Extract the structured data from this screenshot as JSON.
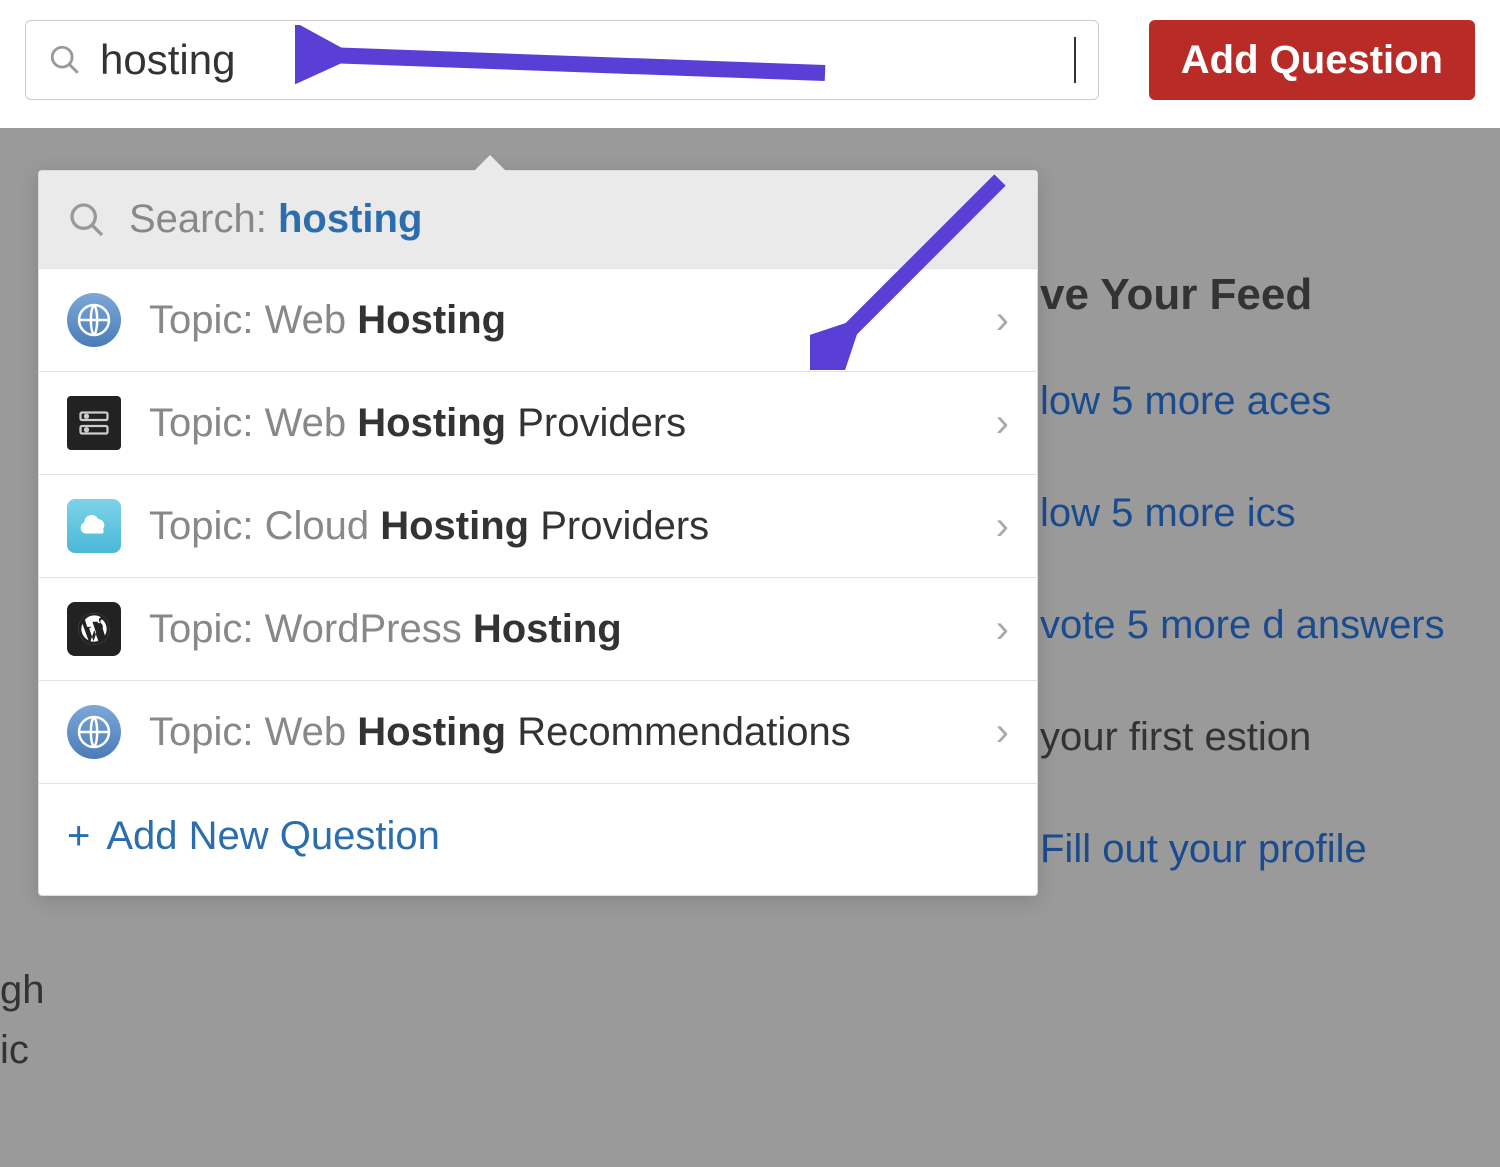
{
  "search": {
    "value": "hosting"
  },
  "add_button": "Add Question",
  "dropdown": {
    "search_prefix": "Search:",
    "search_term": "hosting",
    "items": [
      {
        "prefix": "Topic: Web ",
        "bold": "Hosting",
        "rest": ""
      },
      {
        "prefix": "Topic: Web ",
        "bold": "Hosting",
        "rest": " Providers"
      },
      {
        "prefix": "Topic: Cloud ",
        "bold": "Hosting",
        "rest": " Providers"
      },
      {
        "prefix": "Topic: WordPress ",
        "bold": "Hosting",
        "rest": ""
      },
      {
        "prefix": "Topic: Web ",
        "bold": "Hosting",
        "rest": " Recommendations"
      }
    ],
    "footer": "Add New Question"
  },
  "side": {
    "title": "ve Your Feed",
    "links": [
      "low 5 more aces",
      "low 5 more ics",
      "vote 5 more d answers",
      "your first estion",
      "Fill out your profile"
    ]
  },
  "left_fragments": [
    "gh",
    "ic"
  ]
}
